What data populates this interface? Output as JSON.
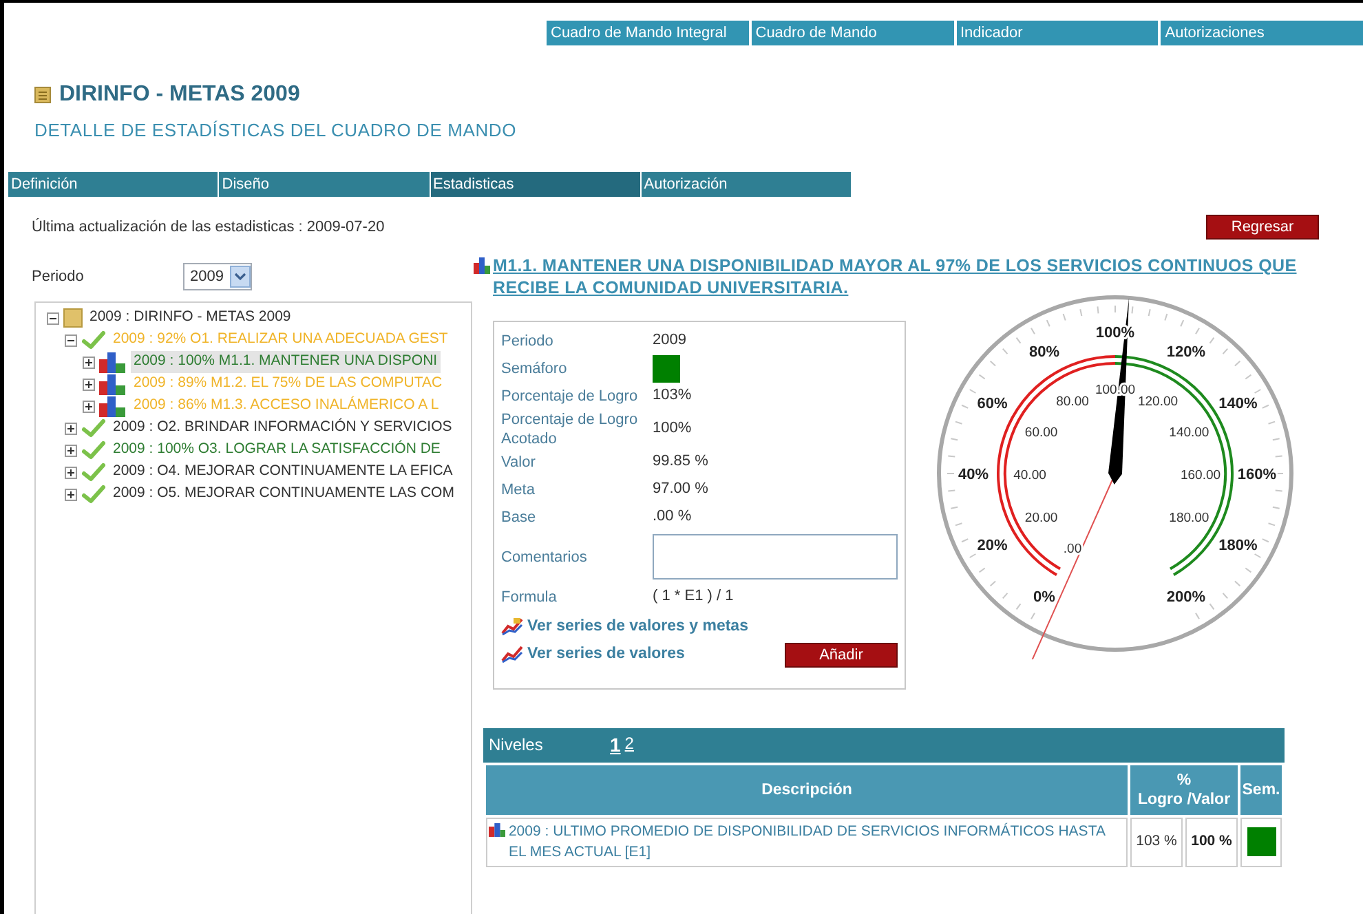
{
  "top_nav": [
    {
      "label": "Cuadro de Mando Integral"
    },
    {
      "label": "Cuadro de Mando"
    },
    {
      "label": "Indicador"
    },
    {
      "label": "Autorizaciones"
    }
  ],
  "title": "DIRINFO - METAS 2009",
  "subtitle": "DETALLE DE ESTADÍSTICAS DEL CUADRO DE MANDO",
  "tabs": [
    {
      "label": "Definición",
      "selected": false
    },
    {
      "label": "Diseño",
      "selected": false
    },
    {
      "label": "Estadisticas",
      "selected": true
    },
    {
      "label": "Autorización",
      "selected": false
    }
  ],
  "last_update": "Última actualización de las estadisticas : 2009-07-20",
  "back_button": "Regresar",
  "period": {
    "label": "Periodo",
    "value": "2009"
  },
  "tree": [
    {
      "kind": "root",
      "text": "2009 : DIRINFO - METAS 2009",
      "color": "#333333",
      "expanded": true,
      "selected": false,
      "children": [
        {
          "kind": "objective",
          "text": "2009 : 92% O1. REALIZAR UNA ADECUADA GEST",
          "color": "#f0b429",
          "expanded": true,
          "selected": false,
          "children": [
            {
              "kind": "measure",
              "text": "2009 : 100% M1.1. MANTENER UNA DISPONI",
              "color": "#2e7d32",
              "expanded": false,
              "selected": true
            },
            {
              "kind": "measure",
              "text": "2009 : 89% M1.2. EL 75% DE LAS COMPUTAC",
              "color": "#f0b429",
              "expanded": false,
              "selected": false
            },
            {
              "kind": "measure",
              "text": "2009 : 86% M1.3. ACCESO INALÁMERICO A L",
              "color": "#f0b429",
              "expanded": false,
              "selected": false
            }
          ]
        },
        {
          "kind": "objective",
          "text": "2009 : O2. BRINDAR INFORMACIÓN Y SERVICIOS",
          "color": "#333333",
          "expanded": false,
          "selected": false
        },
        {
          "kind": "objective",
          "text": "2009 : 100% O3. LOGRAR LA SATISFACCIÓN DE",
          "color": "#2e7d32",
          "expanded": false,
          "selected": false
        },
        {
          "kind": "objective",
          "text": "2009 : O4. MEJORAR CONTINUAMENTE LA EFICA",
          "color": "#333333",
          "expanded": false,
          "selected": false
        },
        {
          "kind": "objective",
          "text": "2009 : O5. MEJORAR CONTINUAMENTE LAS COM",
          "color": "#333333",
          "expanded": false,
          "selected": false
        }
      ]
    }
  ],
  "measure_title": "M1.1. MANTENER UNA DISPONIBILIDAD MAYOR AL 97% DE LOS SERVICIOS CONTINUOS QUE RECIBE LA COMUNIDAD UNIVERSITARIA.",
  "details": [
    {
      "kind": "text",
      "label": "Periodo",
      "value": "2009"
    },
    {
      "kind": "light",
      "label": "Semáforo",
      "color": "#008000"
    },
    {
      "kind": "text",
      "label": "Porcentaje de Logro",
      "value": "103%"
    },
    {
      "kind": "text",
      "label": "Porcentaje de Logro Acotado",
      "value": "100%"
    },
    {
      "kind": "text",
      "label": "Valor",
      "value": "99.85 %"
    },
    {
      "kind": "text",
      "label": "Meta",
      "value": "97.00 %"
    },
    {
      "kind": "text",
      "label": "Base",
      "value": ".00 %"
    },
    {
      "kind": "textarea",
      "label": "Comentarios"
    },
    {
      "kind": "text",
      "label": "Formula",
      "value": "( 1 * E1 ) / 1"
    }
  ],
  "links": [
    {
      "label": "Ver series de valores y metas"
    },
    {
      "label": "Ver series de valores"
    }
  ],
  "add_button": "Añadir",
  "gauge": {
    "outer_labels": [
      "0%",
      "20%",
      "40%",
      "60%",
      "80%",
      "100%",
      "120%",
      "140%",
      "160%",
      "180%",
      "200%"
    ],
    "inner_labels": [
      ".00",
      "20.00",
      "40.00",
      "60.00",
      "80.00",
      "100.00",
      "120.00",
      "140.00",
      "160.00",
      "180.00"
    ]
  },
  "levels": {
    "label": "Niveles",
    "pages": [
      {
        "label": "1",
        "selected": true
      },
      {
        "label": "2",
        "selected": false
      }
    ]
  },
  "table": {
    "columns": [
      "Descripción",
      "%\nLogro /Valor",
      "Sem."
    ],
    "rows": [
      {
        "description": "2009 : ULTIMO PROMEDIO DE DISPONIBILIDAD DE SERVICIOS INFORMÁTICOS HASTA EL MES ACTUAL [E1]",
        "logro": "103 %",
        "valor": "100 %",
        "color": "#008000"
      }
    ]
  }
}
